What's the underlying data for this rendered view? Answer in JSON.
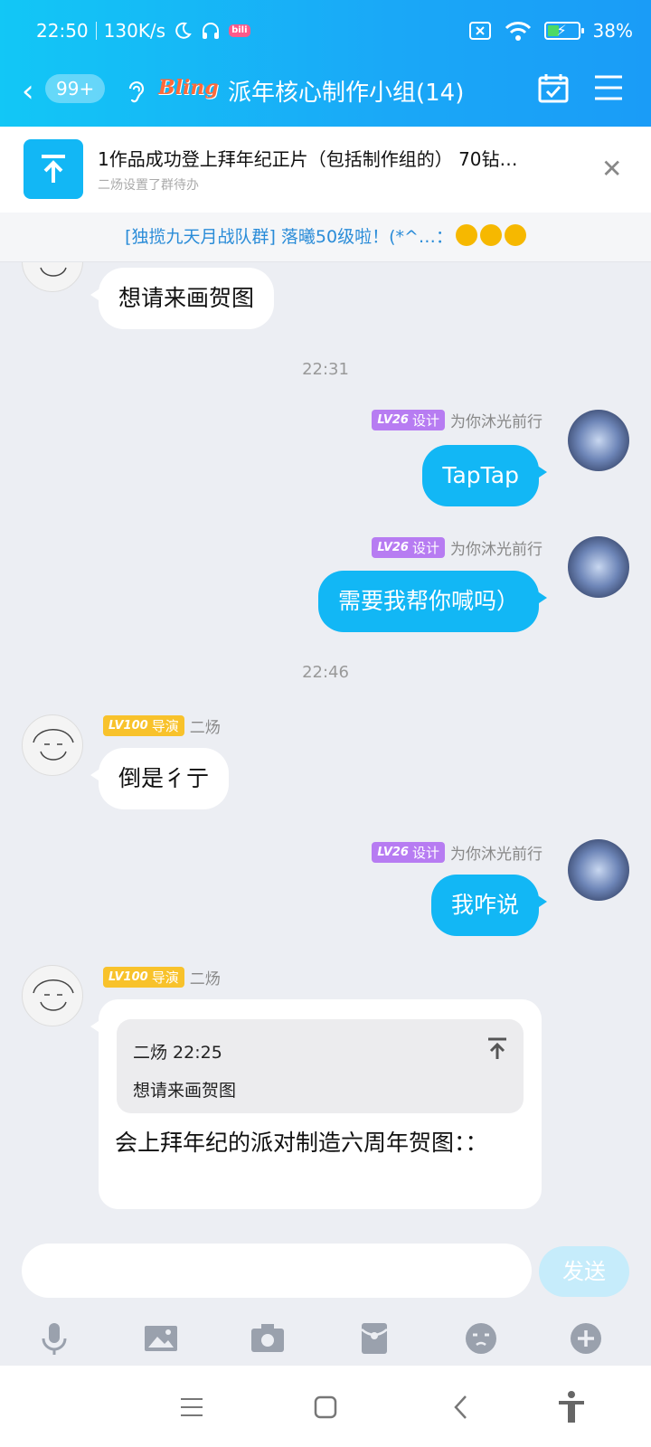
{
  "status_bar": {
    "time": "22:50",
    "net_speed": "130K/s",
    "battery": "38%",
    "battery_level": 0.38,
    "icons": [
      "moon-icon",
      "headset-icon",
      "bilibili-icon",
      "sim-off-icon",
      "wifi-icon",
      "battery-icon"
    ]
  },
  "header": {
    "unread_count": "99+",
    "group_logo_text": "Bling",
    "title": "派年核心制作小组(14)"
  },
  "pinned": {
    "title": "1作品成功登上拜年纪正片（包括制作组的） 70钻…",
    "subtitle": "二炀设置了群待办"
  },
  "notice": {
    "text": "[独揽九天月战队群] 落曦50级啦！(*^…："
  },
  "messages": {
    "m0_text": "想请来画贺图",
    "time1": "22:31",
    "self_level": "LV26",
    "self_title": "设计",
    "self_name": "为你沐光前行",
    "m1_text": "TapTap",
    "m2_text": "需要我帮你喊吗）",
    "time2": "22:46",
    "other_level": "LV100",
    "other_title": "导演",
    "other_name": "二炀",
    "m3_text": "倒是彳亍",
    "m4_text": "我咋说",
    "quote_author_time": "二炀 22:25",
    "quote_text": "想请来画贺图",
    "m5_text": "会上拜年纪的派对制造六周年贺图：："
  },
  "input": {
    "placeholder": "",
    "send_label": "发送"
  }
}
